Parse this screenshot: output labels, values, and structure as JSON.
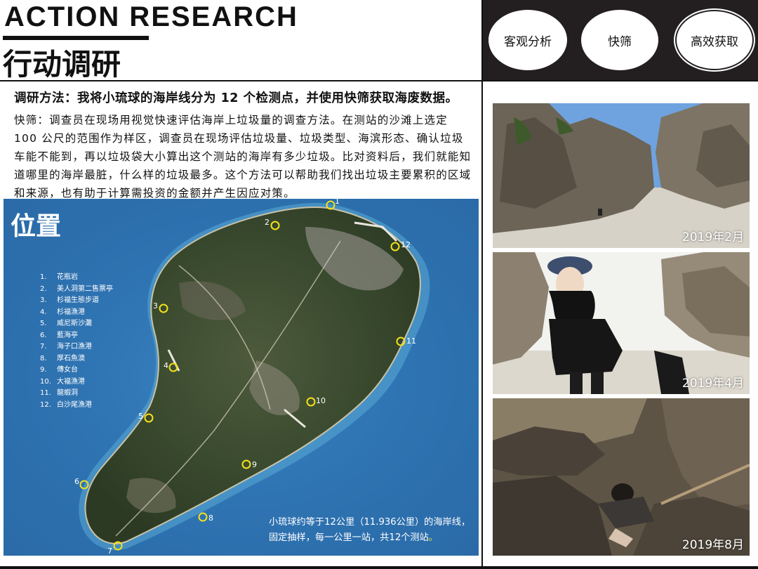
{
  "header": {
    "title_en": "ACTION RESEARCH",
    "title_cn": "行动调研"
  },
  "tags": [
    "客观分析",
    "快筛",
    "高效获取"
  ],
  "method": {
    "heading": "调研方法：我将小琉球的海岸线分为 12 个检测点，并使用快筛获取海废数据。",
    "body": "快筛：调查员在现场用视觉快速评估海岸上垃圾量的调查方法。在测站的沙滩上选定 100 公尺的范围作为样区，调查员在现场评估垃圾量、垃圾类型、海滨形态、确认垃圾车能不能到，再以垃圾袋大小算出这个测站的海岸有多少垃圾。比对资料后，我们就能知道哪里的海岸最脏，什么样的垃圾最多。这个方法可以帮助我们找出垃圾主要累积的区域和来源，也有助于计算需投资的金额并产生因应对策。"
  },
  "map": {
    "title": "位置",
    "legend": [
      {
        "num": "1.",
        "name": "花瓶岩"
      },
      {
        "num": "2.",
        "name": "美人洞第二售票亭"
      },
      {
        "num": "3.",
        "name": "杉福生態步道"
      },
      {
        "num": "4.",
        "name": "杉福漁港"
      },
      {
        "num": "5.",
        "name": "威尼斯沙灘"
      },
      {
        "num": "6.",
        "name": "藍海亭"
      },
      {
        "num": "7.",
        "name": "海子口漁港"
      },
      {
        "num": "8.",
        "name": "厚石魚澳"
      },
      {
        "num": "9.",
        "name": "傳女台"
      },
      {
        "num": "10.",
        "name": "大福漁港"
      },
      {
        "num": "11.",
        "name": "龍蝦洞"
      },
      {
        "num": "12.",
        "name": "白沙尾漁港"
      }
    ],
    "markers": [
      "1",
      "2",
      "3",
      "4",
      "5",
      "6",
      "7",
      "8",
      "9",
      "10",
      "11",
      "12"
    ],
    "caption_main": "小琉球约等于12公里（11.936公里）的海岸线，固定抽样，每一公里一站，共12个测站",
    "caption_end": "。",
    "marker_color": "#f3e11a"
  },
  "photos": [
    {
      "date": "2019年2月"
    },
    {
      "date": "2019年4月"
    },
    {
      "date": "2019年8月"
    }
  ]
}
